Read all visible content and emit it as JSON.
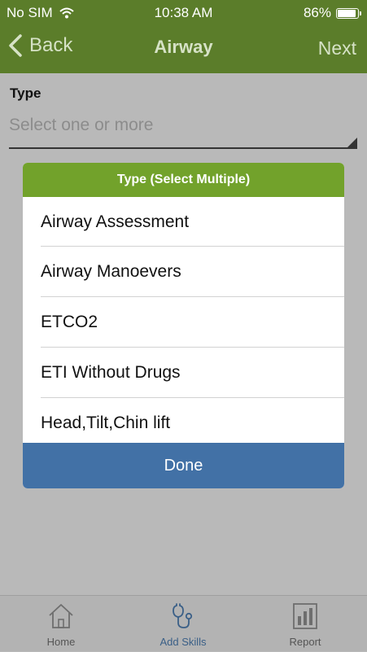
{
  "status_bar": {
    "carrier": "No SIM",
    "time": "10:38 AM",
    "battery": "86%"
  },
  "nav": {
    "back_label": "Back",
    "title": "Airway",
    "next_label": "Next"
  },
  "form": {
    "type_label": "Type",
    "type_placeholder": "Select one or more"
  },
  "dialog": {
    "title": "Type (Select Multiple)",
    "options": [
      "Airway Assessment",
      "Airway Manoevers",
      "ETCO2",
      "ETI Without Drugs",
      "Head,Tilt,Chin lift"
    ],
    "done_label": "Done"
  },
  "tab_bar": {
    "tabs": [
      {
        "label": "Home",
        "icon": "home-icon"
      },
      {
        "label": "Add Skills",
        "icon": "stethoscope-icon"
      },
      {
        "label": "Report",
        "icon": "report-icon"
      }
    ],
    "active": "Add Skills"
  },
  "colors": {
    "nav_green": "#5b7d2a",
    "dialog_header_green": "#72a22b",
    "done_blue": "#4271a6",
    "overlay_gray": "#b9b9b9"
  }
}
